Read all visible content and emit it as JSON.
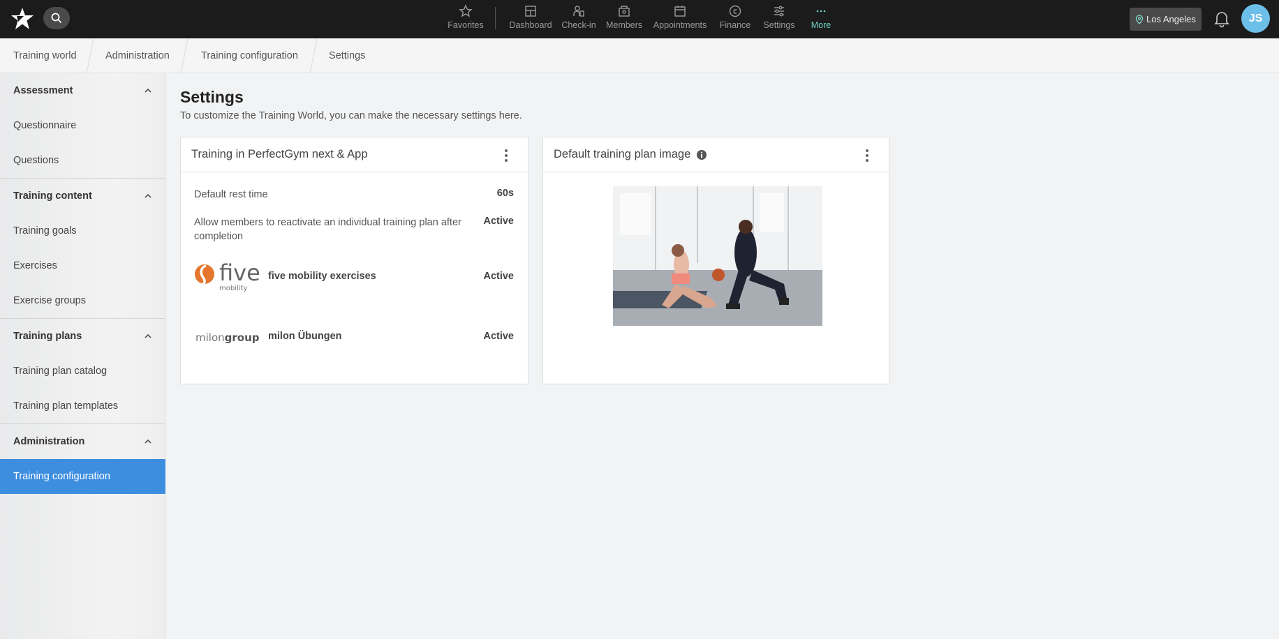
{
  "topbar": {
    "nav": [
      {
        "label": "Favorites",
        "icon": "star-icon"
      },
      {
        "label": "Dashboard",
        "icon": "dashboard-icon"
      },
      {
        "label": "Check-in",
        "icon": "check-in-icon"
      },
      {
        "label": "Members",
        "icon": "members-icon"
      },
      {
        "label": "Appointments",
        "icon": "calendar-icon"
      },
      {
        "label": "Finance",
        "icon": "euro-icon"
      },
      {
        "label": "Settings",
        "icon": "sliders-icon"
      },
      {
        "label": "More",
        "icon": "more-dots-icon"
      }
    ],
    "location": "Los Angeles",
    "avatar_initials": "JS",
    "accent": "#6fd0c5"
  },
  "breadcrumb": [
    "Training world",
    "Administration",
    "Training configuration",
    "Settings"
  ],
  "sidebar": {
    "groups": [
      {
        "label": "Assessment",
        "items": [
          "Questionnaire",
          "Questions"
        ]
      },
      {
        "label": "Training content",
        "items": [
          "Training goals",
          "Exercises",
          "Exercise groups"
        ]
      },
      {
        "label": "Training plans",
        "items": [
          "Training plan catalog",
          "Training plan templates"
        ]
      },
      {
        "label": "Administration",
        "items": [
          "Training configuration"
        ]
      }
    ],
    "active_item": "Training configuration",
    "active_color": "#3e8ee0"
  },
  "main": {
    "title": "Settings",
    "subtitle": "To customize the Training World, you can make the necessary settings here.",
    "card_training": {
      "title": "Training in PerfectGym next & App",
      "rest_label": "Default rest time",
      "rest_value": "60s",
      "reactivate_label": "Allow members to reactivate an individual training plan after completion",
      "reactivate_value": "Active",
      "five_logo_text": "five",
      "five_logo_sub": "mobility",
      "five_name": "five mobility exercises",
      "five_value": "Active",
      "milon_logo_light": "milon",
      "milon_logo_bold": "group",
      "milon_name": "milon Übungen",
      "milon_value": "Active"
    },
    "card_image": {
      "title": "Default training plan image"
    }
  }
}
